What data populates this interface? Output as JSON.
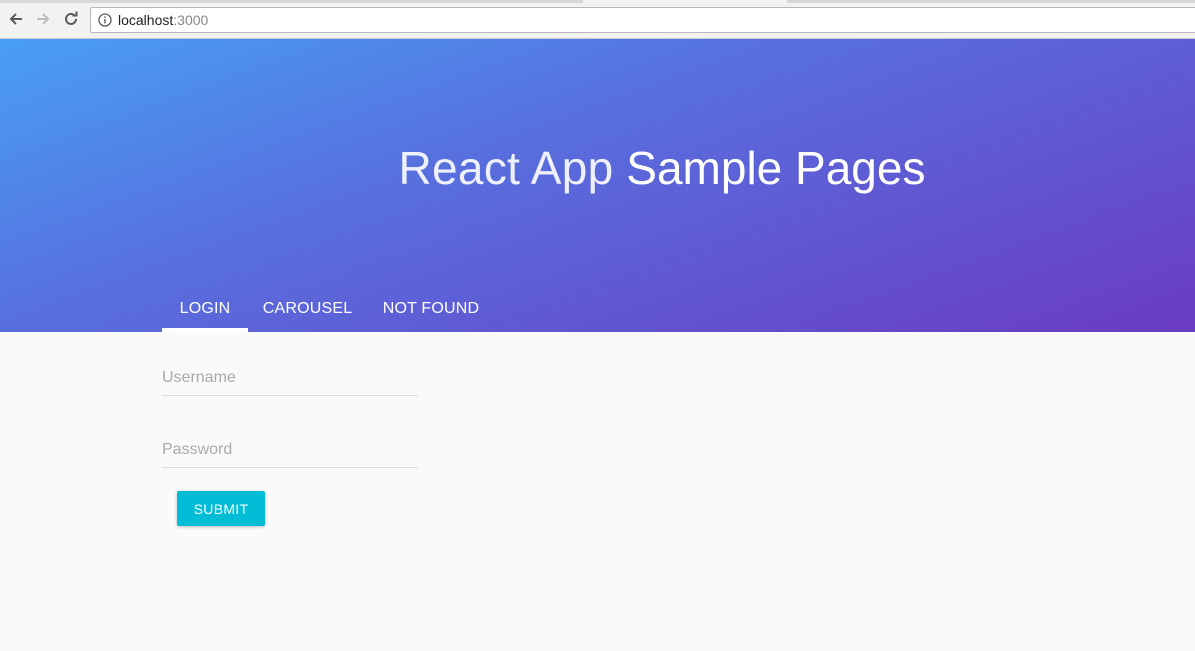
{
  "browser": {
    "url_host": "localhost",
    "url_port": ":3000",
    "icons": [
      "back-arrow-icon",
      "forward-arrow-icon",
      "reload-icon",
      "info-icon"
    ]
  },
  "header": {
    "title_light": "React App",
    "title_strong": "Sample Pages",
    "gradient": [
      "#489ff3",
      "#586fde",
      "#6a3bc3"
    ]
  },
  "tabs": [
    {
      "label": "LOGIN",
      "active": true
    },
    {
      "label": "CAROUSEL",
      "active": false
    },
    {
      "label": "NOT FOUND",
      "active": false
    }
  ],
  "form": {
    "username_placeholder": "Username",
    "username_value": "",
    "password_placeholder": "Password",
    "password_value": "",
    "submit_label": "SUBMIT",
    "submit_color": "#00bcd4"
  }
}
